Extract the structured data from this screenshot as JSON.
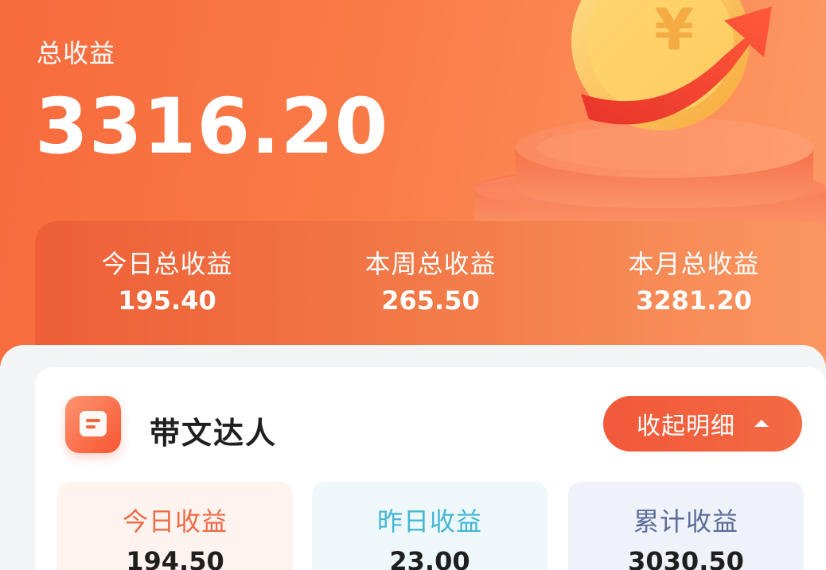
{
  "hero": {
    "title": "总收益",
    "amount": "3316.20"
  },
  "summary": [
    {
      "label": "今日总收益",
      "value": "195.40"
    },
    {
      "label": "本周总收益",
      "value": "265.50"
    },
    {
      "label": "本月总收益",
      "value": "3281.20"
    }
  ],
  "card": {
    "icon": "document-icon",
    "title": "带文达人",
    "collapse_label": "收起明细",
    "collapse_icon": "caret-up-icon",
    "stats": [
      {
        "label": "今日收益",
        "value": "194.50"
      },
      {
        "label": "昨日收益",
        "value": "23.00"
      },
      {
        "label": "累计收益",
        "value": "3030.50"
      }
    ]
  },
  "colors": {
    "brand_orange": "#f76a3c",
    "today_label": "#ef6a45",
    "yesterday_label": "#43b6d4",
    "total_label": "#5a6c9c"
  }
}
